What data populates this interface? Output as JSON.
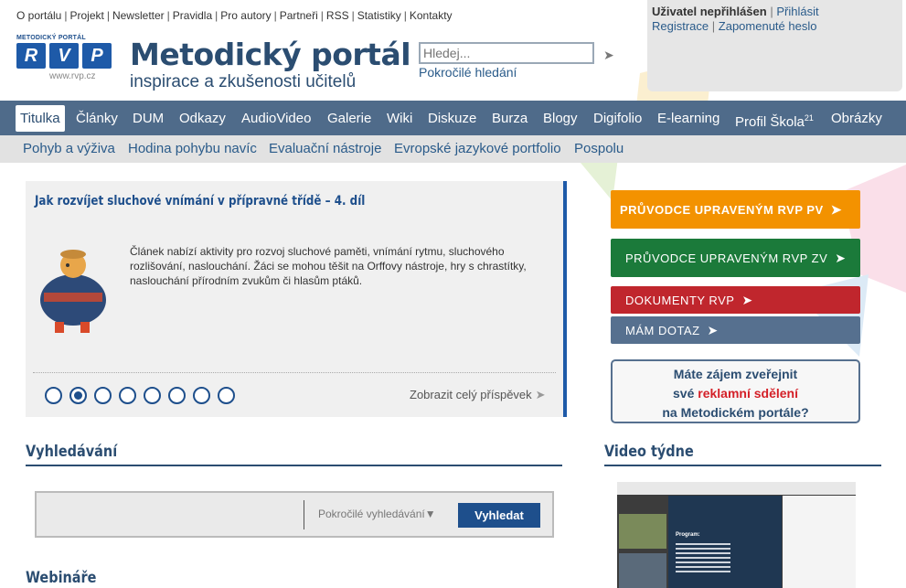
{
  "top_links": [
    "O portálu",
    "Projekt",
    "Newsletter",
    "Pravidla",
    "Pro autory",
    "Partneři",
    "RSS",
    "Statistiky",
    "Kontakty"
  ],
  "user": {
    "status": "Uživatel nepřihlášen",
    "login": "Přihlásit",
    "register": "Registrace",
    "forgot": "Zapomenuté heslo"
  },
  "logo": {
    "small": "METODICKÝ PORTÁL",
    "letters": [
      "R",
      "V",
      "P"
    ],
    "url": "www.rvp.cz"
  },
  "site": {
    "title": "Metodický portál",
    "subtitle": "inspirace a zkušenosti učitelů"
  },
  "search": {
    "placeholder": "Hledej...",
    "advanced": "Pokročilé hledání"
  },
  "nav": [
    "Titulka",
    "Články",
    "DUM",
    "Odkazy",
    "AudioVideo",
    "Galerie",
    "Wiki",
    "Diskuze",
    "Burza",
    "Blogy",
    "Digifolio",
    "E-learning",
    "Profil Škola",
    "Obrázky"
  ],
  "nav_sup": "21",
  "subnav": [
    "Pohyb a výživa",
    "Hodina pohybu navíc",
    "Evaluační nástroje",
    "Evropské jazykové portfolio",
    "Pospolu"
  ],
  "feature": {
    "title": "Jak rozvíjet sluchové vnímání v přípravné třídě – 4. díl",
    "text": "Článek nabízí aktivity pro rozvoj sluchové paměti, vnímání rytmu, sluchového rozlišování, naslouchání. Žáci se mohou těšit na Orffovy nástroje, hry s chrastítky, naslouchání přírodním zvukům či hlasům ptáků.",
    "more": "Zobrazit celý příspěvek",
    "slides": 8,
    "active_slide": 2
  },
  "buttons": {
    "pv": "PRŮVODCE UPRAVENÝM RVP PV",
    "zv": "PRŮVODCE UPRAVENÝM RVP ZV",
    "docs": "DOKUMENTY RVP",
    "ask": "MÁM DOTAZ"
  },
  "promo": {
    "line1": "Máte zájem zveřejnit",
    "line2a": "své ",
    "line2b": "reklamní sdělení",
    "line3": "na Metodickém portále?"
  },
  "sections": {
    "search": "Vyhledávání",
    "video": "Video týdne",
    "webinars": "Webináře"
  },
  "search_box": {
    "advanced": "Pokročilé vyhledávání",
    "submit": "Vyhledat"
  },
  "video": {
    "slide_title": "Program:"
  },
  "colors": {
    "nav_bg": "#4f6b8a",
    "brand": "#1e4f8c",
    "orange": "#f39200",
    "green": "#1b7a3a",
    "red": "#c0262d"
  }
}
